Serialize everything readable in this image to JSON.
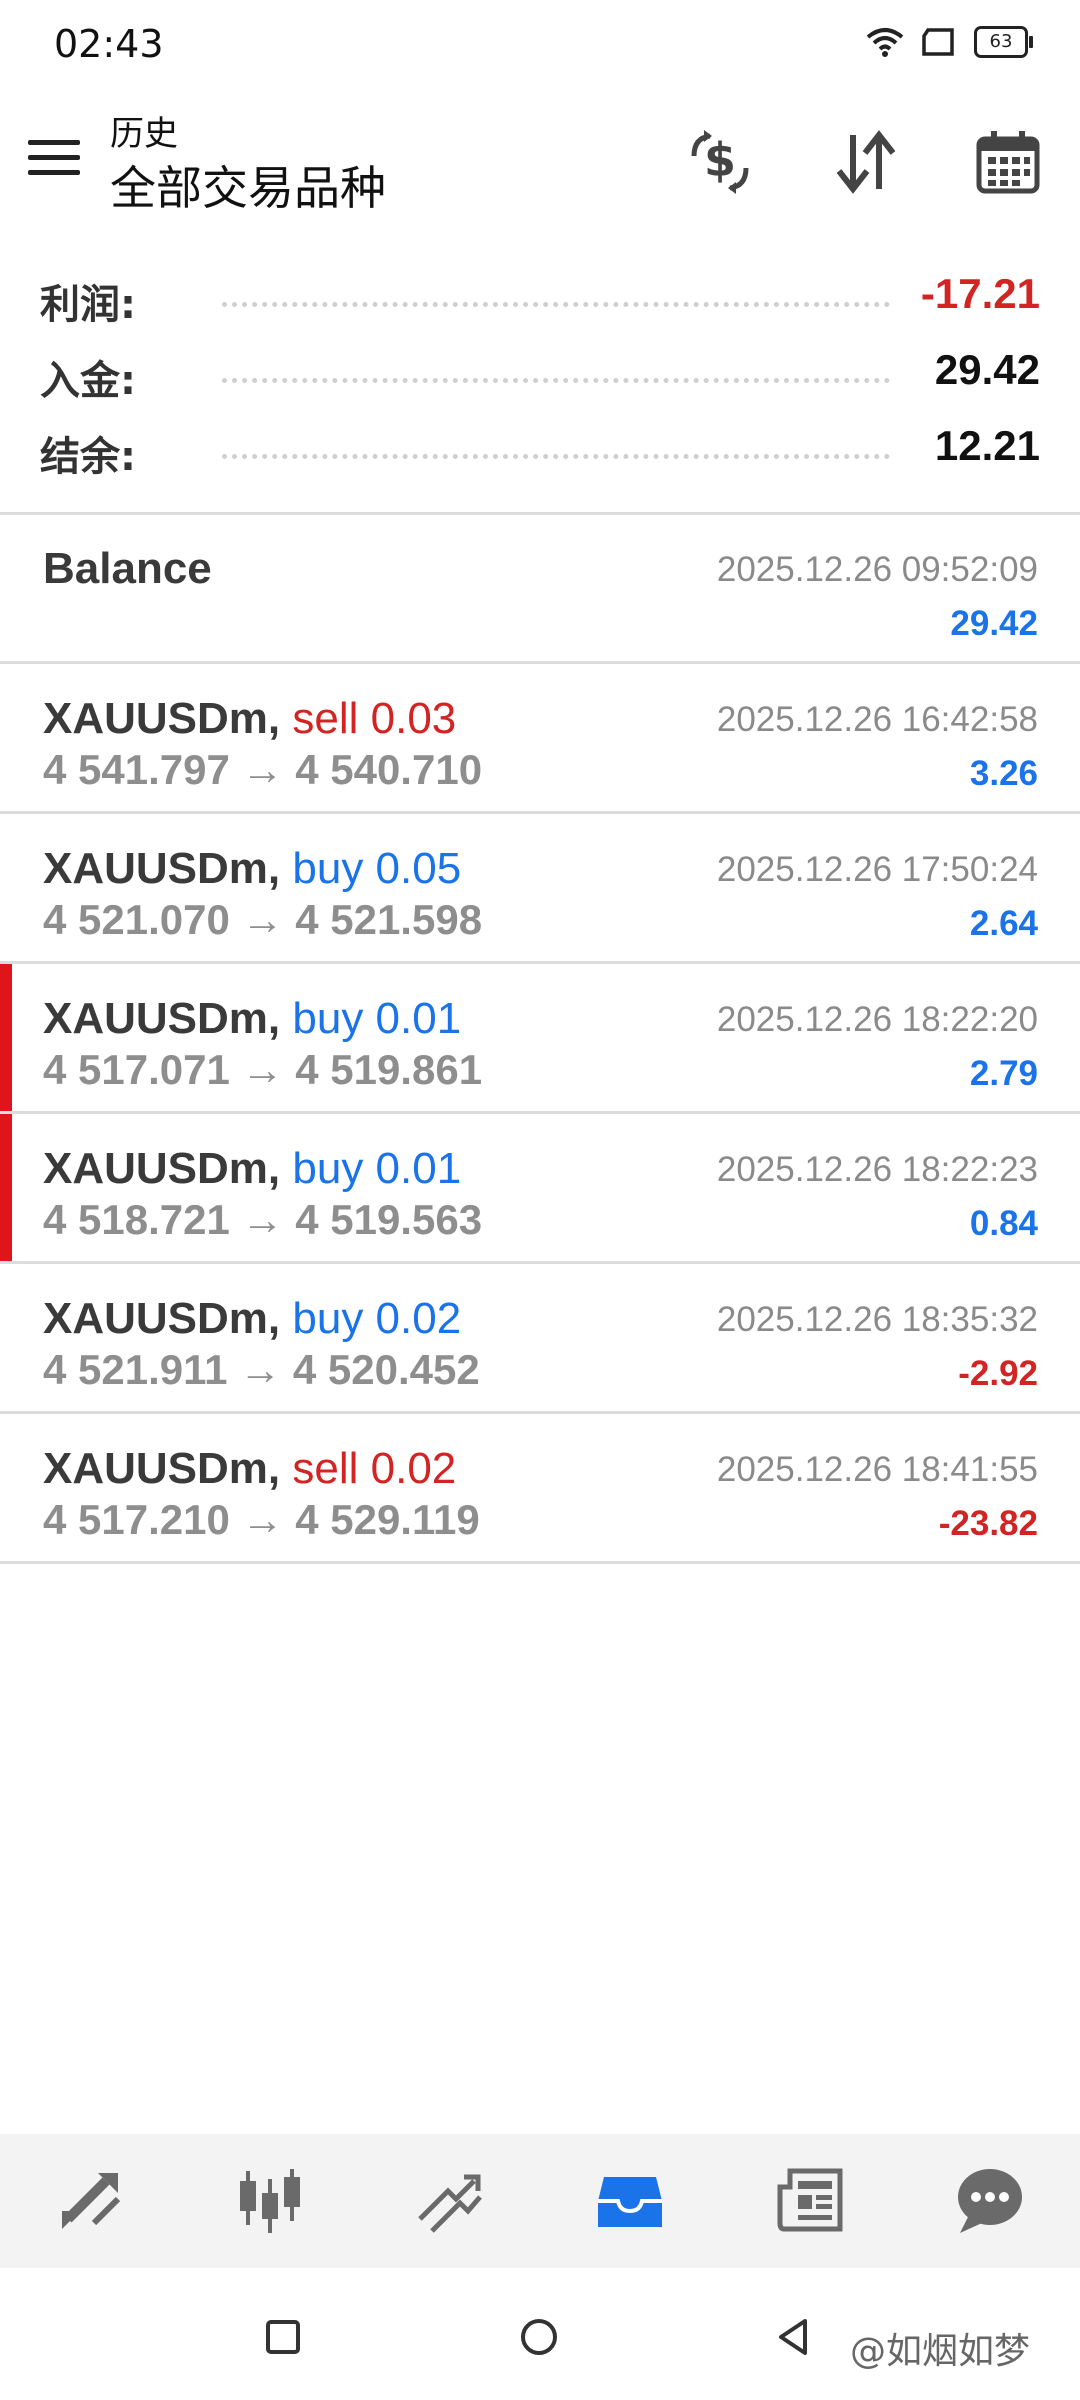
{
  "status_bar": {
    "time": "02:43",
    "battery": "63"
  },
  "header": {
    "subtitle": "历史",
    "title": "全部交易品种"
  },
  "summary": {
    "profit": {
      "label": "利润:",
      "value": "-17.21"
    },
    "deposit": {
      "label": "入金:",
      "value": "29.42"
    },
    "balance": {
      "label": "结余:",
      "value": "12.21"
    }
  },
  "balance_entry": {
    "label": "Balance",
    "time": "2025.12.26 09:52:09",
    "amount": "29.42"
  },
  "deals": [
    {
      "symbol": "XAUUSDm,",
      "type": "sell 0.03",
      "direction": "sell",
      "open": "4 541.797",
      "close": "4 540.710",
      "time": "2025.12.26 16:42:58",
      "profit": "3.26"
    },
    {
      "symbol": "XAUUSDm,",
      "type": "buy 0.05",
      "direction": "buy",
      "open": "4 521.070",
      "close": "4 521.598",
      "time": "2025.12.26 17:50:24",
      "profit": "2.64"
    },
    {
      "symbol": "XAUUSDm,",
      "type": "buy 0.01",
      "direction": "buy",
      "open": "4 517.071",
      "close": "4 519.861",
      "time": "2025.12.26 18:22:20",
      "profit": "2.79"
    },
    {
      "symbol": "XAUUSDm,",
      "type": "buy 0.01",
      "direction": "buy",
      "open": "4 518.721",
      "close": "4 519.563",
      "time": "2025.12.26 18:22:23",
      "profit": "0.84"
    },
    {
      "symbol": "XAUUSDm,",
      "type": "buy 0.02",
      "direction": "buy",
      "open": "4 521.911",
      "close": "4 520.452",
      "time": "2025.12.26 18:35:32",
      "profit": "-2.92"
    },
    {
      "symbol": "XAUUSDm,",
      "type": "sell 0.02",
      "direction": "sell",
      "open": "4 517.210",
      "close": "4 529.119",
      "time": "2025.12.26 18:41:55",
      "profit": "-23.82"
    }
  ],
  "arrow": "→",
  "watermark": "@如烟如梦",
  "colors": {
    "sell": "#d32424",
    "buy": "#1a73e8",
    "positive": "#1a73e8",
    "negative": "#d32424",
    "active_tab": "#1a73e8"
  }
}
